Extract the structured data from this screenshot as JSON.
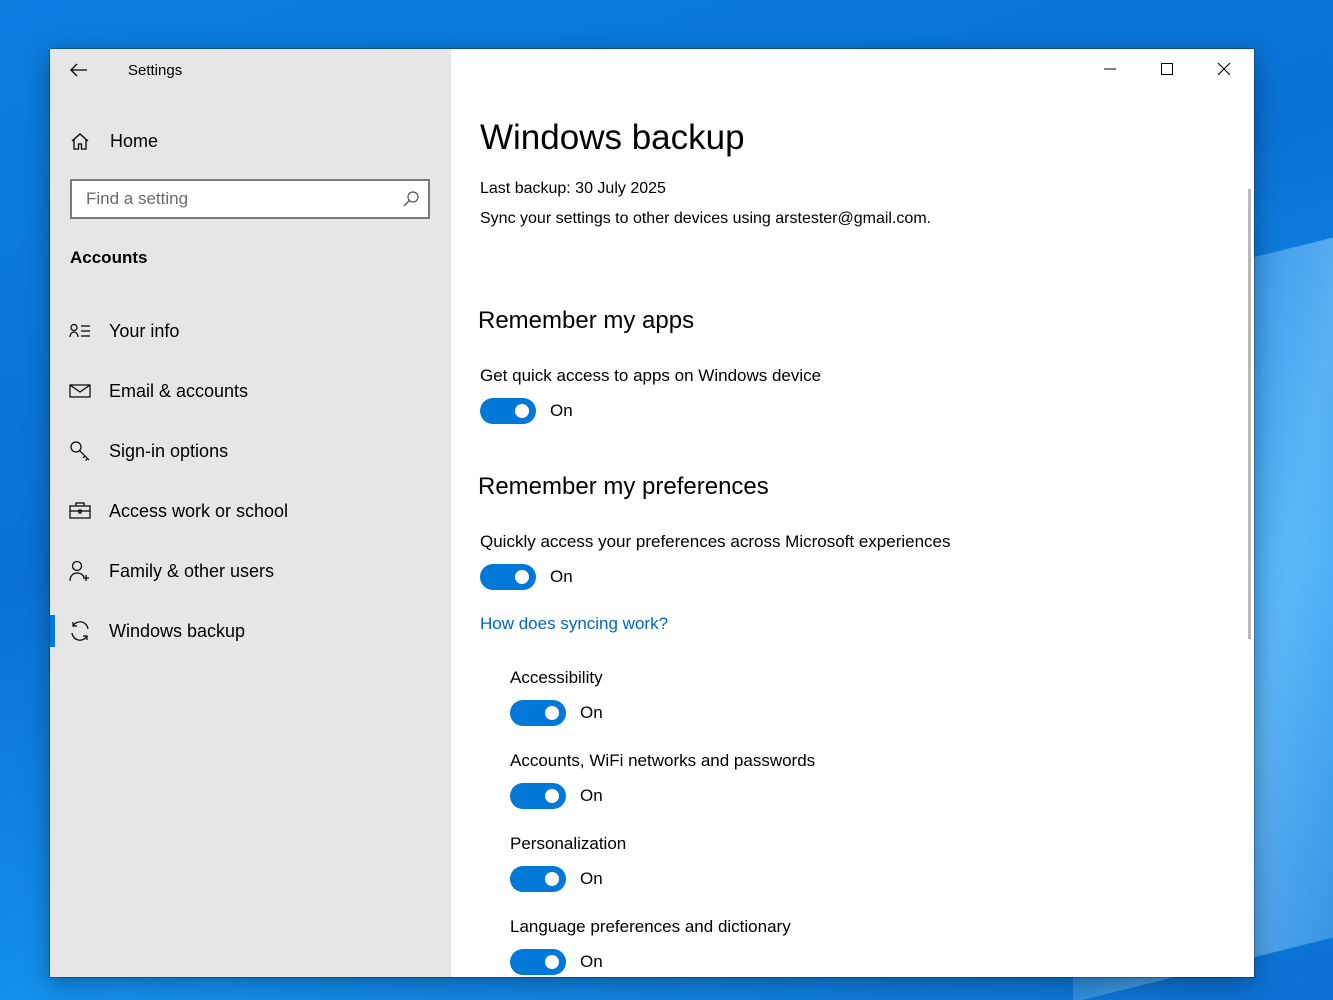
{
  "window": {
    "app_title": "Settings"
  },
  "sidebar": {
    "home_label": "Home",
    "search_placeholder": "Find a setting",
    "section_title": "Accounts",
    "items": [
      {
        "label": "Your info",
        "icon": "person-details-icon"
      },
      {
        "label": "Email & accounts",
        "icon": "mail-icon"
      },
      {
        "label": "Sign-in options",
        "icon": "key-icon"
      },
      {
        "label": "Access work or school",
        "icon": "briefcase-icon"
      },
      {
        "label": "Family & other users",
        "icon": "add-person-icon"
      },
      {
        "label": "Windows backup",
        "icon": "sync-icon",
        "selected": true
      }
    ]
  },
  "main": {
    "title": "Windows backup",
    "last_backup": "Last backup: 30 July 2025",
    "sync_text": "Sync your settings to other devices using arstester@gmail.com.",
    "apps_heading": "Remember my apps",
    "apps_desc": "Get quick access to apps on Windows device",
    "apps_toggle": "On",
    "prefs_heading": "Remember my preferences",
    "prefs_desc": "Quickly access your preferences across Microsoft experiences",
    "prefs_toggle": "On",
    "link": "How does syncing work?",
    "sub_settings": [
      {
        "label": "Accessibility",
        "state": "On"
      },
      {
        "label": "Accounts, WiFi networks and passwords",
        "state": "On"
      },
      {
        "label": "Personalization",
        "state": "On"
      },
      {
        "label": "Language preferences and dictionary",
        "state": "On"
      }
    ]
  },
  "colors": {
    "accent": "#0078d7",
    "link": "#0067c0",
    "sidebar_bg": "#e6e6e6"
  }
}
